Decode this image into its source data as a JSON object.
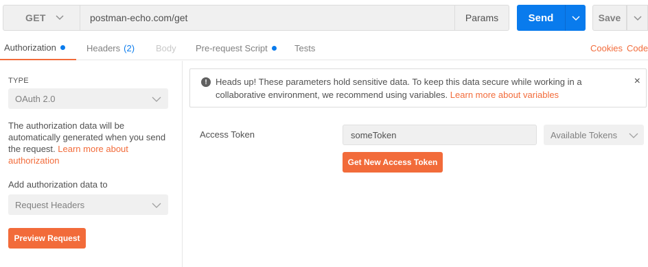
{
  "request": {
    "method": "GET",
    "url": "postman-echo.com/get",
    "params_label": "Params",
    "send_label": "Send",
    "save_label": "Save"
  },
  "tabs": [
    {
      "label": "Authorization",
      "indicator": "dot",
      "active": true
    },
    {
      "label": "Headers",
      "count": "(2)"
    },
    {
      "label": "Body",
      "disabled": true
    },
    {
      "label": "Pre-request Script",
      "indicator": "dot"
    },
    {
      "label": "Tests"
    }
  ],
  "tab_links": {
    "cookies": "Cookies",
    "code": "Code"
  },
  "auth": {
    "type_label": "TYPE",
    "type_value": "OAuth 2.0",
    "description": "The authorization data will be automatically generated when you send the request.",
    "learn_more": "Learn more about authorization",
    "add_to_label": "Add authorization data to",
    "add_to_value": "Request Headers",
    "preview_label": "Preview Request"
  },
  "alert": {
    "text": "Heads up! These parameters hold sensitive data. To keep this data secure while working in a collaborative environment, we recommend using variables.",
    "link": "Learn more about variables",
    "close": "×"
  },
  "token": {
    "label": "Access Token",
    "value": "someToken",
    "available_label": "Available Tokens",
    "get_new_label": "Get New Access Token"
  },
  "colors": {
    "accent": "#f26b3a",
    "primary": "#097bed",
    "field_bg": "#f0f0f0"
  },
  "icons": {
    "method_dropdown": "chevron-down-icon",
    "send_dropdown": "chevron-down-icon",
    "save_dropdown": "chevron-down-icon",
    "alert": "exclamation-circle-icon",
    "close": "close-icon"
  }
}
